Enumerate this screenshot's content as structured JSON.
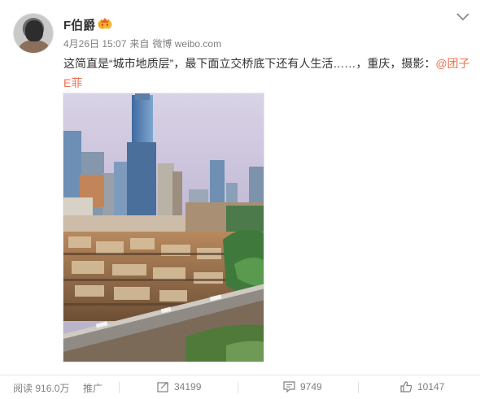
{
  "post": {
    "author": "F伯爵",
    "timestamp": "4月26日 15:07",
    "source_prefix": "来自",
    "source": "微博 weibo.com",
    "text": "这简直是“城市地质层”，最下面立交桥底下还有人生活……，重庆，摄影：",
    "mention": "@团子E菲"
  },
  "footer": {
    "read_label": "阅读",
    "read_count": "916.0万",
    "promote_label": "推广",
    "repost_count": "34199",
    "comment_count": "9749",
    "like_count": "10147"
  },
  "icons": {
    "badge": "vip-badge-icon",
    "menu": "chevron-down-icon",
    "repost": "repost-icon",
    "comment": "comment-icon",
    "like": "thumbs-up-icon"
  },
  "colors": {
    "mention": "#eb7350",
    "meta": "#808080",
    "badge": "#f5a623"
  }
}
